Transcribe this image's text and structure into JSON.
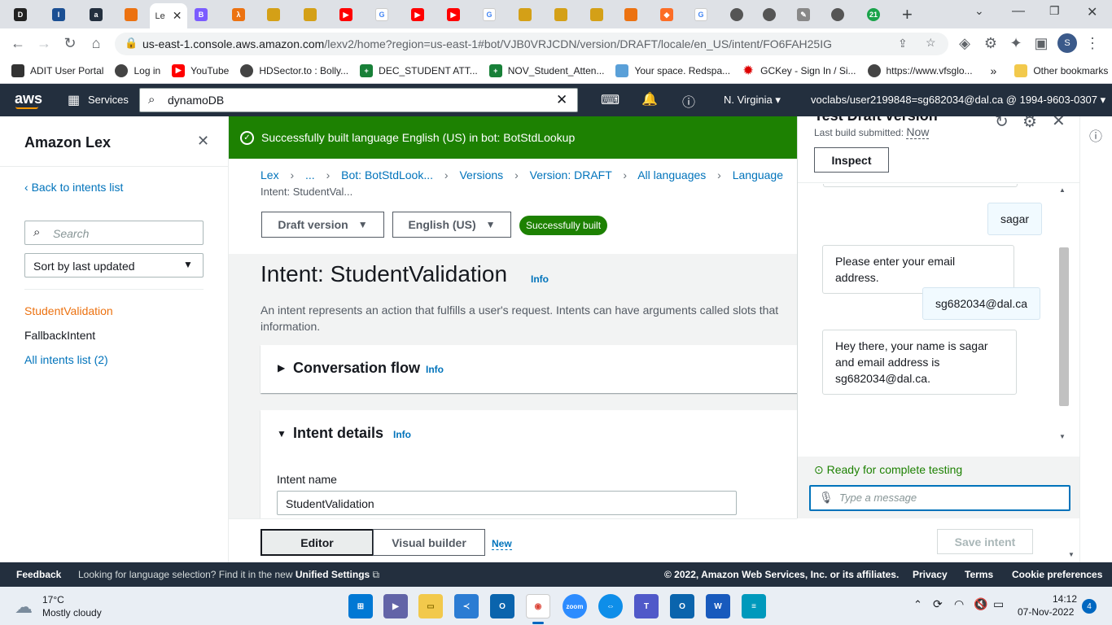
{
  "browser": {
    "active_tab_label": "Le",
    "url_host": "us-east-1.console.aws.amazon.com",
    "url_path": "/lexv2/home?region=us-east-1#bot/VJB0VRJCDN/version/DRAFT/locale/en_US/intent/FO6FAH25IG",
    "bookmarks": [
      "ADIT User Portal",
      "Log in",
      "YouTube",
      "HDSector.to : Bolly...",
      "DEC_STUDENT ATT...",
      "NOV_Student_Atten...",
      "Your space. Redspa...",
      "GCKey - Sign In / Si...",
      "https://www.vfsglo..."
    ],
    "more_bookmarks": "»",
    "other_bookmarks": "Other bookmarks"
  },
  "aws_header": {
    "logo": "aws",
    "services": "Services",
    "search_value": "dynamoDB",
    "region": "N. Virginia",
    "account": "voclabs/user2199848=sg682034@dal.ca @ 1994-9603-0307"
  },
  "left_nav": {
    "title": "Amazon Lex",
    "back_link": "Back to intents list",
    "search_placeholder": "Search",
    "sort_label": "Sort by last updated",
    "intents": [
      "StudentValidation",
      "FallbackIntent"
    ],
    "all_intents": "All intents list (2)"
  },
  "main": {
    "flash_message": "Successfully built language English (US) in bot: BotStdLookup",
    "breadcrumb": [
      "Lex",
      "...",
      "Bot: BotStdLook...",
      "Versions",
      "Version: DRAFT",
      "All languages",
      "Language"
    ],
    "breadcrumb_current": "Intent: StudentVal...",
    "version_dropdown": "Draft version",
    "language_dropdown": "English (US)",
    "build_status": "Successfully built",
    "page_title": "Intent: StudentValidation",
    "info": "Info",
    "description_line1": "An intent represents an action that fulfills a user's request. Intents can have arguments called slots that",
    "description_line2": "information.",
    "section_conversation": "Conversation flow",
    "section_details": "Intent details",
    "intent_name_label": "Intent name",
    "intent_name_value": "StudentValidation",
    "tab_editor": "Editor",
    "tab_visual": "Visual builder",
    "new_badge": "New",
    "save_button": "Save intent"
  },
  "test_panel": {
    "title": "Test Draft version",
    "last_build_label": "Last build submitted:",
    "last_build_value": "Now",
    "inspect": "Inspect",
    "messages": [
      {
        "from": "user",
        "text": "sagar"
      },
      {
        "from": "bot",
        "text": "Please enter your email address."
      },
      {
        "from": "user",
        "text": "sg682034@dal.ca"
      },
      {
        "from": "bot",
        "line1": "Hey there, your name is sagar",
        "line2": "and email address is",
        "line3": "sg682034@dal.ca."
      }
    ],
    "status": "Ready for complete testing",
    "input_placeholder": "Type a message"
  },
  "footer": {
    "feedback": "Feedback",
    "notice": "Looking for language selection? Find it in the new",
    "unified": "Unified Settings",
    "copyright": "© 2022, Amazon Web Services, Inc. or its affiliates.",
    "privacy": "Privacy",
    "terms": "Terms",
    "cookies": "Cookie preferences"
  },
  "taskbar": {
    "temp": "17°C",
    "weather": "Mostly cloudy",
    "time": "14:12",
    "date": "07-Nov-2022",
    "notif_count": "4"
  },
  "colors": {
    "aws_dark": "#232f3e",
    "success_green": "#1d8102",
    "link_blue": "#0073bb",
    "active_orange": "#ec7211"
  }
}
